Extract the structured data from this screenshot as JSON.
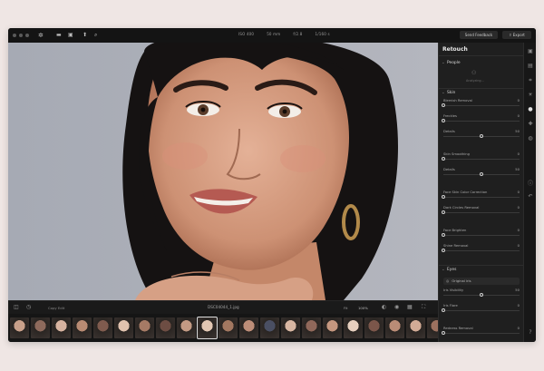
{
  "toolbar": {
    "meta": [
      "ISO 400",
      "50 mm",
      "f/2.8",
      "1/160 s"
    ],
    "feedback_label": "Send Feedback",
    "export_label": "Export"
  },
  "bottom": {
    "copy_edit_label": "Copy Edit",
    "filename": "DSC04044_1.jpg",
    "fit_label": "Fit",
    "zoom_label": "100%"
  },
  "panel": {
    "title": "Retouch",
    "people": {
      "title": "People",
      "detected": "Analyzing..."
    },
    "skin": {
      "title": "Skin",
      "sliders": [
        {
          "label": "Blemish Removal",
          "value": "0",
          "level": 0.0
        },
        {
          "label": "Freckles",
          "value": "0",
          "level": 0.0
        },
        {
          "label": "Details",
          "value": "50",
          "level": 0.5
        },
        {
          "label": "Skin Smoothing",
          "value": "0",
          "level": 0.0
        },
        {
          "label": "Details",
          "value": "50",
          "level": 0.5
        },
        {
          "label": "Face Skin Color Correction",
          "value": "0",
          "level": 0.0
        },
        {
          "label": "Dark Circles Removal",
          "value": "0",
          "level": 0.0
        },
        {
          "label": "Face Brighten",
          "value": "0",
          "level": 0.0
        },
        {
          "label": "Shine Removal",
          "value": "0",
          "level": 0.0
        }
      ]
    },
    "eyes": {
      "title": "Eyes",
      "iris_select": "Original iris",
      "sliders": [
        {
          "label": "Iris Visibility",
          "value": "50",
          "level": 0.5
        },
        {
          "label": "Iris Flare",
          "value": "0",
          "level": 0.0
        },
        {
          "label": "Redness Removal",
          "value": "0",
          "level": 0.0
        }
      ]
    }
  },
  "colors": {
    "accent": "#e8e8e8",
    "window": "#1b1b1b",
    "canvas_bg": "#a9adb7"
  },
  "filmstrip": {
    "count": 21
  }
}
